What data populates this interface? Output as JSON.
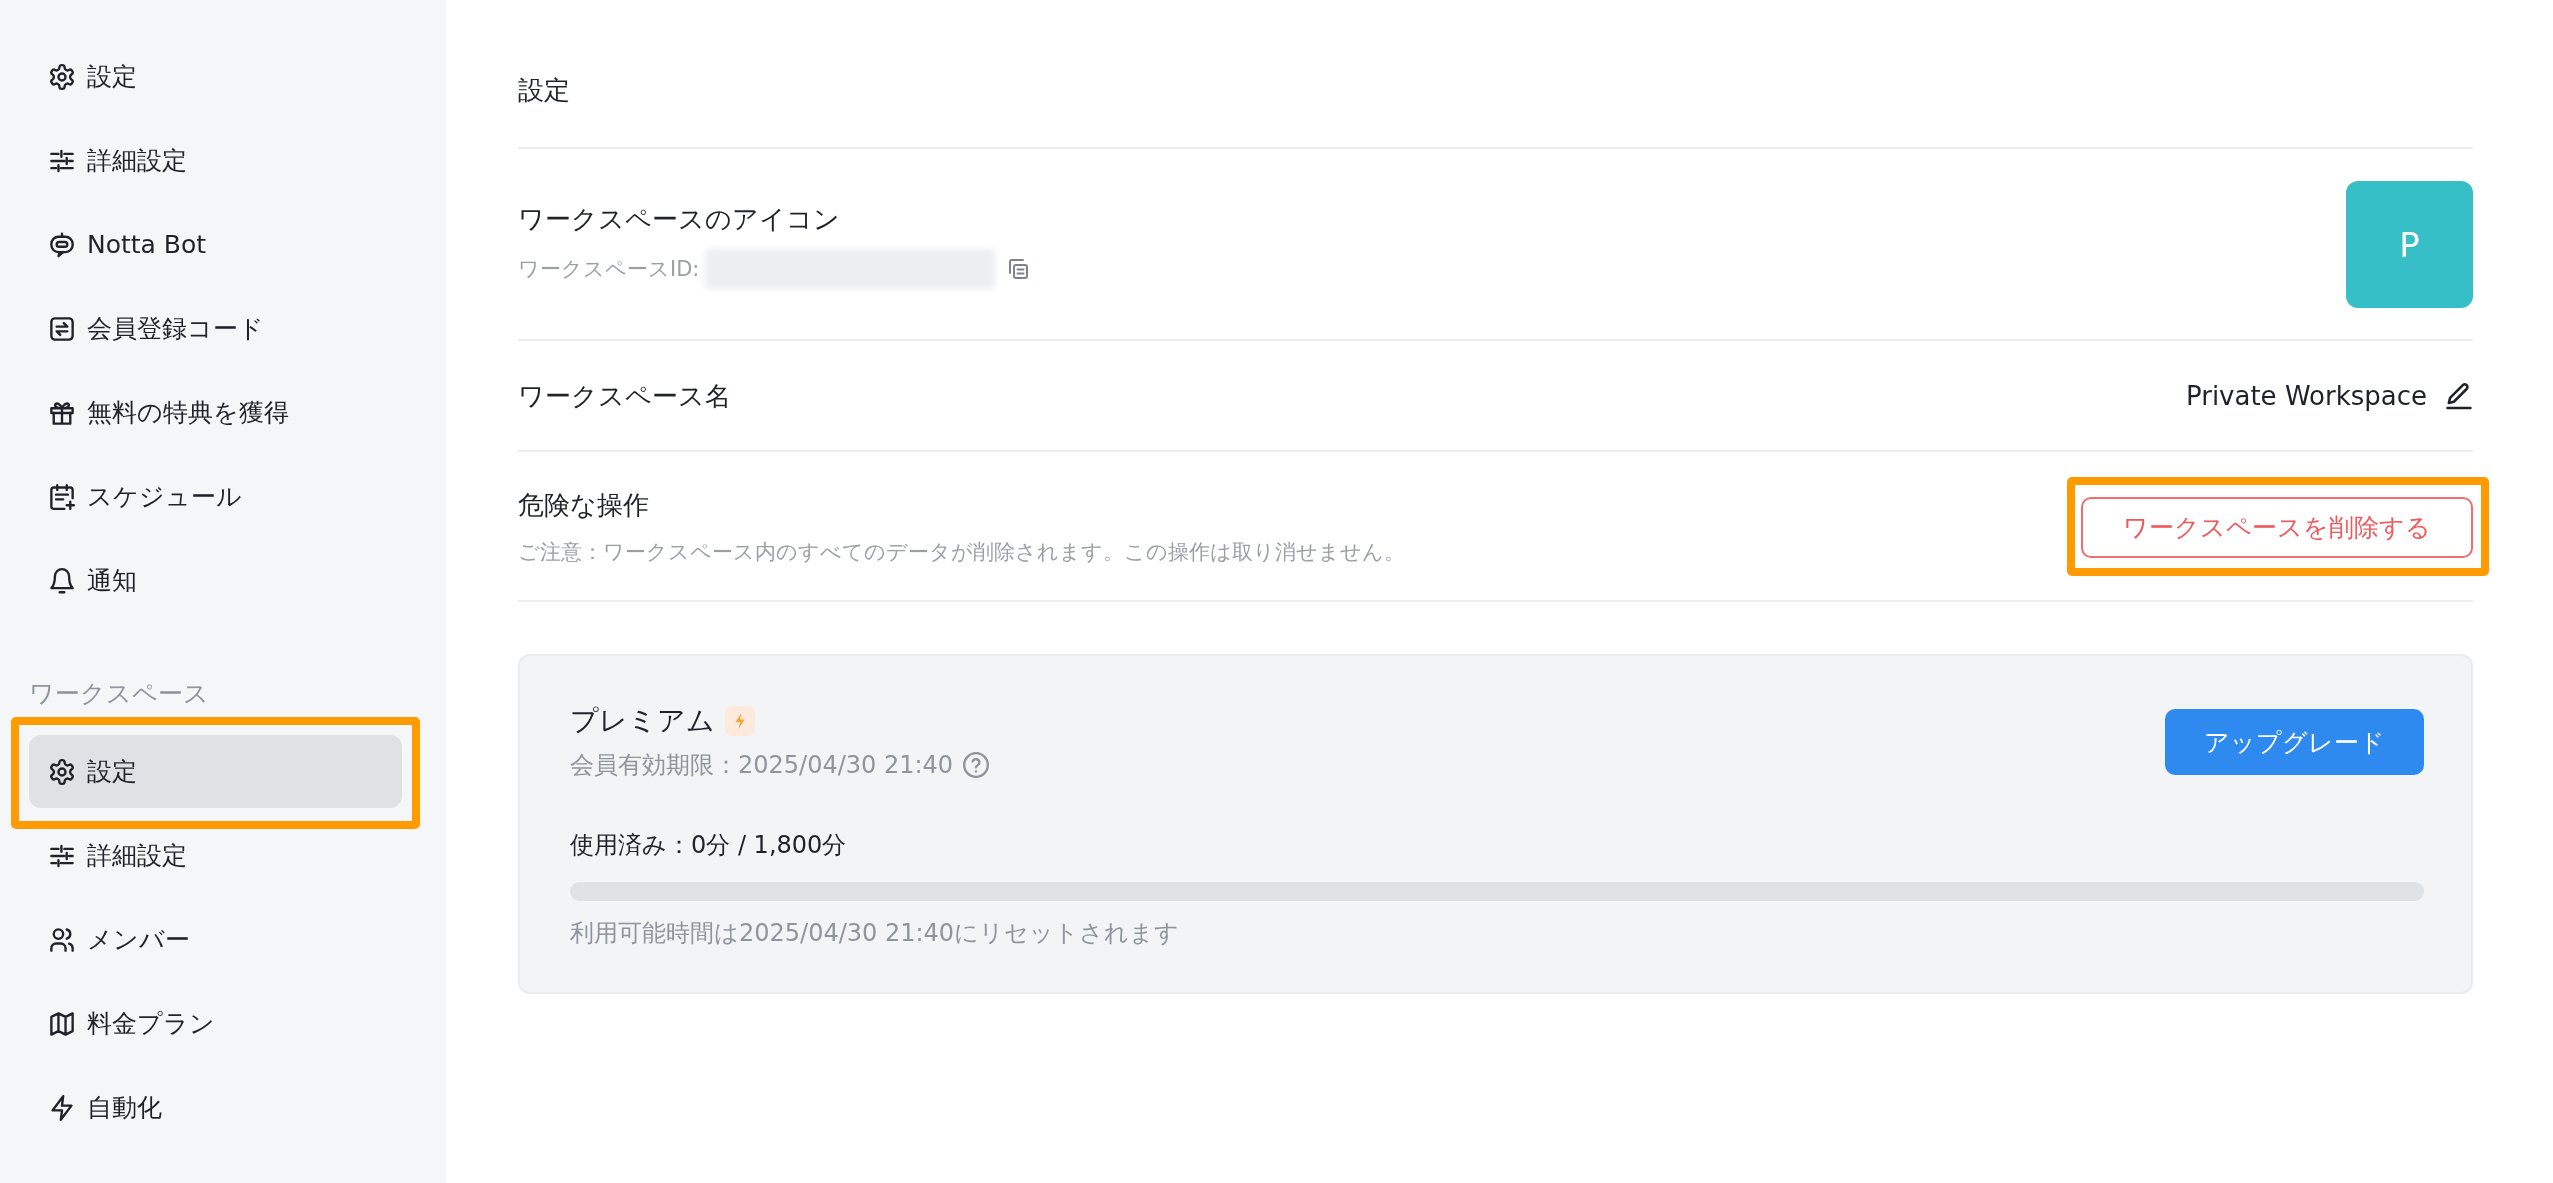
{
  "sidebar": {
    "sections": [
      {
        "items": [
          {
            "label": "設定",
            "selected": false,
            "highlighted": false
          },
          {
            "label": "詳細設定",
            "selected": false,
            "highlighted": false
          },
          {
            "label": "Notta Bot",
            "selected": false,
            "highlighted": false
          },
          {
            "label": "会員登録コード",
            "selected": false,
            "highlighted": false
          },
          {
            "label": "無料の特典を獲得",
            "selected": false,
            "highlighted": false
          },
          {
            "label": "スケジュール",
            "selected": false,
            "highlighted": false
          },
          {
            "label": "通知",
            "selected": false,
            "highlighted": false
          }
        ]
      },
      {
        "title": "ワークスペース",
        "items": [
          {
            "label": "設定",
            "selected": true,
            "highlighted": true
          },
          {
            "label": "詳細設定",
            "selected": false,
            "highlighted": false
          },
          {
            "label": "メンバー",
            "selected": false,
            "highlighted": false
          },
          {
            "label": "料金プラン",
            "selected": false,
            "highlighted": false
          },
          {
            "label": "自動化",
            "selected": false,
            "highlighted": false
          }
        ]
      }
    ]
  },
  "main": {
    "title": "設定",
    "rows": [
      {
        "kind": "avatar",
        "label": "ワークスペースのアイコン",
        "id_label": "ワークスペースID:",
        "avatar_letter": "P"
      },
      {
        "kind": "name",
        "label": "ワークスペース名",
        "value": "Private Workspace"
      },
      {
        "kind": "danger",
        "label": "危険な操作",
        "description": "ご注意：ワークスペース内のすべてのデータが削除されます。この操作は取り消せません。",
        "button": {
          "label": "ワークスペースを削除する",
          "highlighted": true
        }
      }
    ],
    "plan": {
      "name": "プレミアム",
      "expiry": "会員有効期限：2025/04/30 21:40",
      "upgrade_button": "アップグレード",
      "usage": {
        "label": "使用済み：0分 / 1,800分",
        "level": 0
      },
      "reset_note": "利用可能時間は2025/04/30 21:40にリセットされます"
    }
  }
}
